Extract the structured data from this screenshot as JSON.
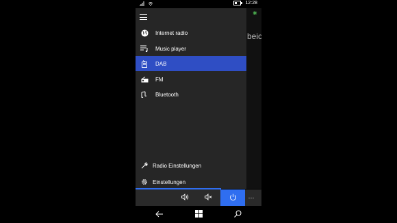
{
  "status": {
    "time": "12:28"
  },
  "background": {
    "partial_text": "beich"
  },
  "menu": {
    "items": [
      {
        "label": "Internet radio",
        "icon": "globe-icon"
      },
      {
        "label": "Music player",
        "icon": "music-list-icon"
      },
      {
        "label": "DAB",
        "icon": "radio-portable-icon",
        "active": true
      },
      {
        "label": "FM",
        "icon": "radio-icon"
      },
      {
        "label": "Bluetooth",
        "icon": "bluetooth-icon"
      }
    ],
    "bottom": [
      {
        "label": "Radio Einstellungen",
        "icon": "wrench-icon"
      },
      {
        "label": "Einstellungen",
        "icon": "gear-icon"
      }
    ]
  },
  "appbar": {
    "buttons": [
      "volume-icon",
      "mute-icon",
      "power-icon",
      "more-icon"
    ],
    "more_label": "···"
  },
  "colors": {
    "accent": "#2f4ec4",
    "drawer_bg": "#262626",
    "appbar_active": "#2f6ef0"
  }
}
